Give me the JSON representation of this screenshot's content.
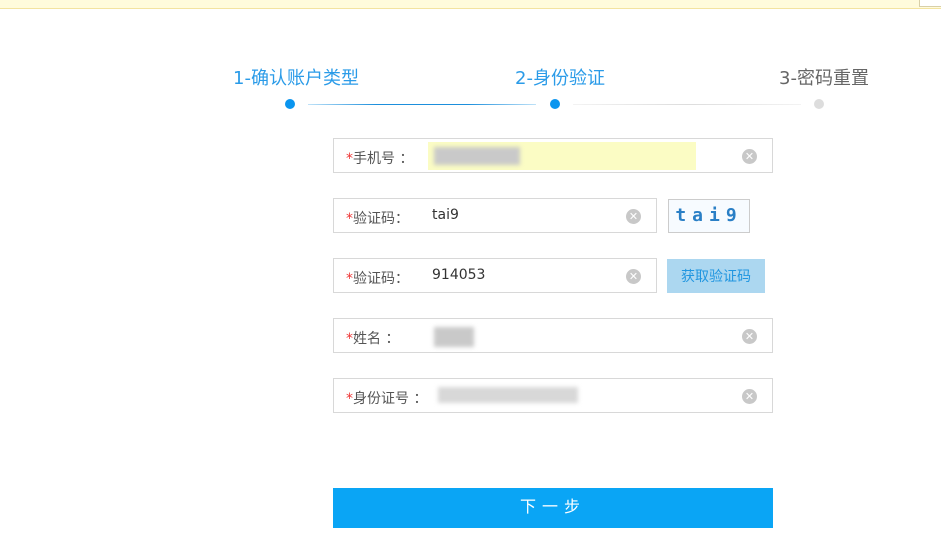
{
  "steps": [
    {
      "label": "1-确认账户类型",
      "state": "done"
    },
    {
      "label": "2-身份验证",
      "state": "active"
    },
    {
      "label": "3-密码重置",
      "state": "pending"
    }
  ],
  "form": {
    "required_mark": "*",
    "phone": {
      "label": "手机号 ："
    },
    "captcha": {
      "label": "验证码：",
      "value": "tai9",
      "image_text": "tai9"
    },
    "sms_code": {
      "label": "验证码：",
      "value": "914053",
      "button": "获取验证码"
    },
    "name": {
      "label": "姓名 ："
    },
    "id_number": {
      "label": "身份证号 ："
    },
    "clear_glyph": "✕"
  },
  "next_button": "下一步",
  "colors": {
    "accent": "#0aa5f5",
    "step_active": "#2a9be8",
    "required": "#ee3333"
  }
}
